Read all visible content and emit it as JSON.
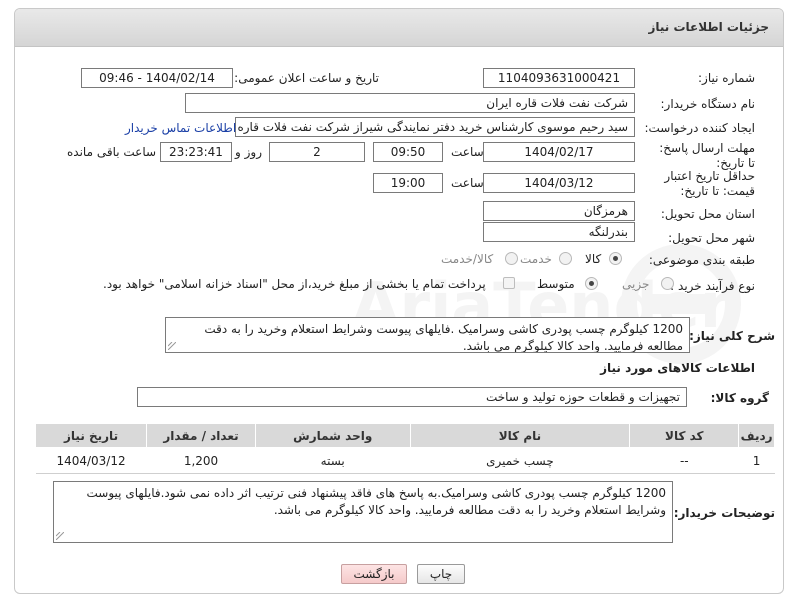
{
  "panel": {
    "title": "جزئیات اطلاعات نیاز"
  },
  "form": {
    "need_number": {
      "label": "شماره نیاز:",
      "value": "1104093631000421"
    },
    "announce": {
      "label": "تاریخ و ساعت اعلان عمومی:",
      "value": "1404/02/14 - 09:46"
    },
    "buyer_org": {
      "label": "نام دستگاه خریدار:",
      "value": "شرکت نفت فلات قاره ایران"
    },
    "creator": {
      "label": "ایجاد کننده درخواست:",
      "value": "سید رحیم موسوی کارشناس خرید دفتر نمایندگی شیراز شرکت نفت فلات قاره ا",
      "contact_link": "اطلاعات تماس خریدار"
    },
    "reply_deadline": {
      "label": "مهلت ارسال پاسخ: تا تاریخ:",
      "date": "1404/02/17",
      "time_label": "ساعت",
      "time": "09:50",
      "days": "2",
      "days_label": "روز و",
      "remaining": "23:23:41",
      "remaining_label": "ساعت باقی مانده"
    },
    "price_validity": {
      "label": "حداقل تاریخ اعتبار قیمت: تا تاریخ:",
      "date": "1404/03/12",
      "time_label": "ساعت",
      "time": "19:00"
    },
    "province": {
      "label": "استان محل تحویل:",
      "value": "هرمزگان"
    },
    "city": {
      "label": "شهر محل تحویل:",
      "value": "بندرلنگه"
    },
    "category": {
      "label": "طبقه بندی موضوعی:",
      "options": [
        "کالا",
        "خدمت",
        "کالا/خدمت"
      ],
      "selected": 0
    },
    "purchase_type": {
      "label": "نوع فرآیند خرید :",
      "options": [
        "جزیی",
        "متوسط"
      ],
      "selected": 1,
      "payment_note": "پرداخت تمام یا بخشی از مبلغ خرید،از محل \"اسناد خزانه اسلامی\" خواهد بود."
    },
    "general_desc": {
      "label": "شرح کلی نیاز:",
      "value": "1200 کیلوگرم چسب پودری کاشی وسرامیک .فایلهای پیوست وشرایط استعلام وخرید را به دقت مطالعه فرمایید. واحد کالا کیلوگرم می باشد."
    }
  },
  "goods": {
    "section_title": "اطلاعات کالاهای مورد نیاز",
    "group_label": "گروه کالا:",
    "group_value": "تجهیزات و قطعات حوزه تولید و ساخت",
    "columns": [
      "ردیف",
      "کد کالا",
      "نام کالا",
      "واحد شمارش",
      "تعداد / مقدار",
      "تاریخ نیاز"
    ],
    "rows": [
      {
        "row": "1",
        "code": "--",
        "name": "چسب خمیری",
        "unit": "بسته",
        "qty": "1,200",
        "date": "1404/03/12"
      }
    ]
  },
  "buyer_notes": {
    "label": "توضیحات خریدار:",
    "value": "1200 کیلوگرم چسب پودری کاشی وسرامیک.به پاسخ های فاقد پیشنهاد فنی ترتیب اثر داده نمی شود.فایلهای پیوست وشرایط استعلام وخرید را به دقت مطالعه فرمایید. واحد کالا کیلوگرم می باشد."
  },
  "buttons": {
    "print": "چاپ",
    "back": "بازگشت"
  },
  "colors": {
    "link": "#1a3fa6",
    "header_bg": "#dcdcdc",
    "table_header": "#d9d9d9",
    "back_button": "#f5caca"
  }
}
